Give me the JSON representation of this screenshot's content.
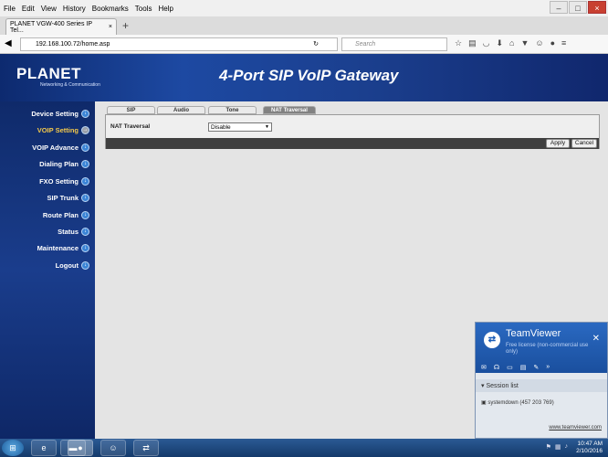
{
  "menu": [
    "File",
    "Edit",
    "View",
    "History",
    "Bookmarks",
    "Tools",
    "Help"
  ],
  "tab": {
    "title": "PLANET VGW-400 Series IP Tel..."
  },
  "url": "192.168.100.72/home.asp",
  "search_placeholder": "Search",
  "header": {
    "logo": "PLANET",
    "logo_sub": "Networking & Communication",
    "title": "4-Port SIP VoIP Gateway"
  },
  "sidebar": [
    "Device Setting",
    "VOIP Setting",
    "VOIP Advance",
    "Dialing Plan",
    "FXO Setting",
    "SIP Trunk",
    "Route Plan",
    "Status",
    "Maintenance",
    "Logout"
  ],
  "content_tabs": [
    "SIP",
    "Audio",
    "Tone",
    "NAT Traversal"
  ],
  "nat": {
    "label": "NAT Traversal",
    "value": "Disable"
  },
  "buttons": {
    "apply": "Apply",
    "cancel": "Cancel"
  },
  "teamviewer": {
    "name": "TeamViewer",
    "license": "Free license (non-commercial use only)",
    "session": "Session list",
    "item": "systemdown (457 203 769)",
    "link": "www.teamviewer.com"
  },
  "clock": {
    "time": "10:47 AM",
    "date": "2/10/2016"
  }
}
